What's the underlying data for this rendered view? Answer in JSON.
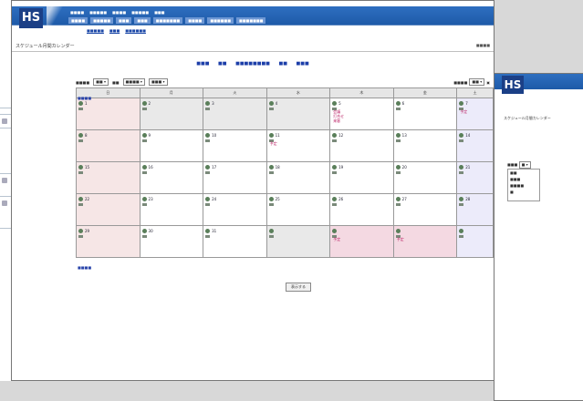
{
  "main_window": {
    "logo": "HS",
    "title": "スケジュール月間カレンダー",
    "button_label": "表示する",
    "weekdays": [
      "日",
      "月",
      "火",
      "水",
      "木",
      "金",
      "土"
    ],
    "weeks": [
      [
        {
          "d": "1",
          "cls": "hol"
        },
        {
          "d": "2",
          "cls": "off"
        },
        {
          "d": "3",
          "cls": "off"
        },
        {
          "d": "4",
          "cls": "off"
        },
        {
          "d": "5",
          "cls": "",
          "ev": [
            "会議",
            "打合せ",
            "来客"
          ]
        },
        {
          "d": "6",
          "cls": ""
        },
        {
          "d": "7",
          "cls": "sat",
          "ev": [
            "予定"
          ]
        }
      ],
      [
        {
          "d": "8",
          "cls": "hol"
        },
        {
          "d": "9",
          "cls": ""
        },
        {
          "d": "10",
          "cls": ""
        },
        {
          "d": "11",
          "cls": "",
          "ev": [
            "予定"
          ]
        },
        {
          "d": "12",
          "cls": ""
        },
        {
          "d": "13",
          "cls": ""
        },
        {
          "d": "14",
          "cls": "sat"
        }
      ],
      [
        {
          "d": "15",
          "cls": "hol"
        },
        {
          "d": "16",
          "cls": ""
        },
        {
          "d": "17",
          "cls": ""
        },
        {
          "d": "18",
          "cls": ""
        },
        {
          "d": "19",
          "cls": ""
        },
        {
          "d": "20",
          "cls": ""
        },
        {
          "d": "21",
          "cls": "sat"
        }
      ],
      [
        {
          "d": "22",
          "cls": "hol"
        },
        {
          "d": "23",
          "cls": ""
        },
        {
          "d": "24",
          "cls": ""
        },
        {
          "d": "25",
          "cls": ""
        },
        {
          "d": "26",
          "cls": ""
        },
        {
          "d": "27",
          "cls": ""
        },
        {
          "d": "28",
          "cls": "sat"
        }
      ],
      [
        {
          "d": "29",
          "cls": "hol"
        },
        {
          "d": "30",
          "cls": ""
        },
        {
          "d": "31",
          "cls": ""
        },
        {
          "d": "",
          "cls": "off"
        },
        {
          "d": "",
          "cls": "today",
          "ev": [
            "予定"
          ]
        },
        {
          "d": "",
          "cls": "today",
          "ev": [
            "予定"
          ]
        },
        {
          "d": "",
          "cls": "sat"
        }
      ]
    ]
  },
  "colors": {
    "header_blue": "#1e5aa8",
    "event_pink": "#bb2266",
    "link_blue": "#1c3ea8"
  },
  "second_window": {
    "logo": "HS",
    "title": "スケジュール月間カレンダー"
  },
  "icons": [
    "calendar-icon",
    "user-icon",
    "nav-left-icon",
    "nav-right-icon"
  ]
}
